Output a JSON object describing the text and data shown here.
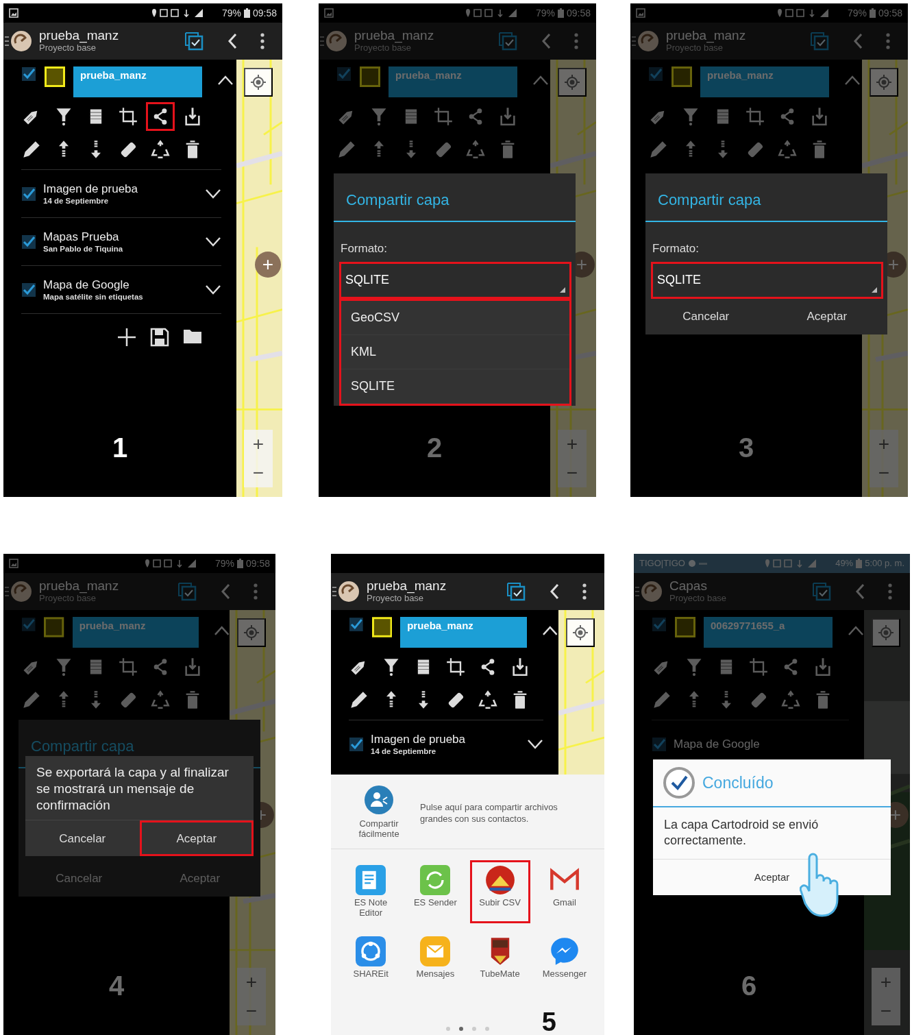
{
  "panels": [
    {
      "step": "1",
      "dimmed": false,
      "status_bar": {
        "kind": "dark",
        "battery": "79%",
        "time": "09:58"
      },
      "app_bar": {
        "title": "prueba_manz",
        "subtitle": "Proyecto base"
      },
      "active_layer": {
        "name": "prueba_manz",
        "checked": true,
        "expanded": true
      },
      "tools": [
        {
          "kind": "tag",
          "highlighted": false
        },
        {
          "kind": "filter",
          "highlighted": false
        },
        {
          "kind": "table",
          "highlighted": false
        },
        {
          "kind": "crop",
          "highlighted": false
        },
        {
          "kind": "share",
          "highlighted": true
        },
        {
          "kind": "export",
          "highlighted": false
        },
        {
          "kind": "pencil",
          "highlighted": false
        },
        {
          "kind": "up",
          "highlighted": false
        },
        {
          "kind": "down",
          "highlighted": false
        },
        {
          "kind": "eraser",
          "highlighted": false
        },
        {
          "kind": "recycle",
          "highlighted": false
        },
        {
          "kind": "trash",
          "highlighted": false
        }
      ],
      "layers": [
        {
          "title": "Imagen de prueba",
          "subtitle": "14 de Septiembre",
          "checked": true,
          "expanded": false
        },
        {
          "title": "Mapas Prueba",
          "subtitle": "San Pablo de Tiquina",
          "checked": true,
          "expanded": false
        },
        {
          "title": "Mapa de Google",
          "subtitle": "Mapa satélite sin etiquetas",
          "checked": true,
          "expanded": false
        }
      ],
      "layer_actions": true,
      "map": {
        "kind": "street",
        "fab": "+",
        "zoom_in": "+",
        "zoom_out": "−"
      }
    },
    {
      "step": "2",
      "dimmed": true,
      "status_bar": {
        "kind": "dark",
        "battery": "79%",
        "time": "09:58"
      },
      "app_bar": {
        "title": "prueba_manz",
        "subtitle": "Proyecto base"
      },
      "active_layer": {
        "name": "prueba_manz",
        "checked": true,
        "expanded": true
      },
      "tools": [
        {
          "kind": "tag",
          "highlighted": false
        },
        {
          "kind": "filter",
          "highlighted": false
        },
        {
          "kind": "table",
          "highlighted": false
        },
        {
          "kind": "crop",
          "highlighted": false
        },
        {
          "kind": "share",
          "highlighted": false
        },
        {
          "kind": "export",
          "highlighted": false
        },
        {
          "kind": "pencil",
          "highlighted": false
        },
        {
          "kind": "up",
          "highlighted": false
        },
        {
          "kind": "down",
          "highlighted": false
        },
        {
          "kind": "eraser",
          "highlighted": false
        },
        {
          "kind": "recycle",
          "highlighted": false
        },
        {
          "kind": "trash",
          "highlighted": false
        }
      ],
      "map": {
        "kind": "street",
        "fab": "+",
        "zoom_in": "+",
        "zoom_out": "−"
      },
      "dialogs": [
        {
          "kind": "format",
          "dimmed": false,
          "title": "Compartir capa",
          "label": "Formato:",
          "select": {
            "value": "SQLITE",
            "highlighted": true
          },
          "dropdown": {
            "highlighted": true,
            "options": [
              "GeoCSV",
              "KML",
              "SQLITE"
            ]
          }
        }
      ]
    },
    {
      "step": "3",
      "dimmed": true,
      "status_bar": {
        "kind": "dark",
        "battery": "79%",
        "time": "09:58"
      },
      "app_bar": {
        "title": "prueba_manz",
        "subtitle": "Proyecto base"
      },
      "active_layer": {
        "name": "prueba_manz",
        "checked": true,
        "expanded": true
      },
      "tools": [
        {
          "kind": "tag",
          "highlighted": false
        },
        {
          "kind": "filter",
          "highlighted": false
        },
        {
          "kind": "table",
          "highlighted": false
        },
        {
          "kind": "crop",
          "highlighted": false
        },
        {
          "kind": "share",
          "highlighted": false
        },
        {
          "kind": "export",
          "highlighted": false
        },
        {
          "kind": "pencil",
          "highlighted": false
        },
        {
          "kind": "up",
          "highlighted": false
        },
        {
          "kind": "down",
          "highlighted": false
        },
        {
          "kind": "eraser",
          "highlighted": false
        },
        {
          "kind": "recycle",
          "highlighted": false
        },
        {
          "kind": "trash",
          "highlighted": false
        }
      ],
      "map": {
        "kind": "street",
        "fab": "+",
        "zoom_in": "+",
        "zoom_out": "−"
      },
      "dialogs": [
        {
          "kind": "format",
          "dimmed": false,
          "title": "Compartir capa",
          "label": "Formato:",
          "select": {
            "value": "SQLITE",
            "highlighted": true
          },
          "buttons": [
            {
              "label": "Cancelar",
              "highlighted": false
            },
            {
              "label": "Aceptar",
              "highlighted": false
            }
          ]
        }
      ]
    },
    {
      "step": "4",
      "dimmed": true,
      "status_bar": {
        "kind": "dark",
        "battery": "79%",
        "time": "09:58"
      },
      "app_bar": {
        "title": "prueba_manz",
        "subtitle": "Proyecto base"
      },
      "active_layer": {
        "name": "prueba_manz",
        "checked": true,
        "expanded": true
      },
      "tools": [
        {
          "kind": "tag",
          "highlighted": false
        },
        {
          "kind": "filter",
          "highlighted": false
        },
        {
          "kind": "table",
          "highlighted": false
        },
        {
          "kind": "crop",
          "highlighted": false
        },
        {
          "kind": "share",
          "highlighted": false
        },
        {
          "kind": "export",
          "highlighted": false
        },
        {
          "kind": "pencil",
          "highlighted": false
        },
        {
          "kind": "up",
          "highlighted": false
        },
        {
          "kind": "down",
          "highlighted": false
        },
        {
          "kind": "eraser",
          "highlighted": false
        },
        {
          "kind": "recycle",
          "highlighted": false
        },
        {
          "kind": "trash",
          "highlighted": false
        }
      ],
      "map": {
        "kind": "street",
        "fab": "+",
        "zoom_in": "+",
        "zoom_out": "−"
      },
      "dialogs": [
        {
          "kind": "format",
          "dimmed": true,
          "title": "Compartir capa",
          "buttons": [
            {
              "label": "Cancelar",
              "highlighted": false
            },
            {
              "label": "Aceptar",
              "highlighted": false
            }
          ]
        },
        {
          "kind": "message",
          "dimmed": false,
          "text": "Se exportará la capa y al finalizar se mostrará un mensaje de confirmación",
          "buttons": [
            {
              "label": "Cancelar",
              "highlighted": false
            },
            {
              "label": "Aceptar",
              "highlighted": true
            }
          ]
        }
      ]
    },
    {
      "step": "5",
      "dimmed": false,
      "app_bar": {
        "title": "prueba_manz",
        "subtitle": "Proyecto base"
      },
      "active_layer": {
        "name": "prueba_manz",
        "checked": true,
        "expanded": true
      },
      "tools": [
        {
          "kind": "tag",
          "highlighted": false
        },
        {
          "kind": "filter",
          "highlighted": false
        },
        {
          "kind": "table",
          "highlighted": false
        },
        {
          "kind": "crop",
          "highlighted": false
        },
        {
          "kind": "share",
          "highlighted": false
        },
        {
          "kind": "export",
          "highlighted": false
        },
        {
          "kind": "pencil",
          "highlighted": false
        },
        {
          "kind": "up",
          "highlighted": false
        },
        {
          "kind": "down",
          "highlighted": false
        },
        {
          "kind": "eraser",
          "highlighted": false
        },
        {
          "kind": "recycle",
          "highlighted": false
        },
        {
          "kind": "trash",
          "highlighted": false
        }
      ],
      "layers": [
        {
          "title": "Imagen de prueba",
          "subtitle": "14 de Septiembre",
          "checked": true,
          "expanded": false
        }
      ],
      "map": {
        "kind": "street"
      },
      "share_sheet": {
        "quick_label": "Compartir fácilmente",
        "quick_text": "Pulse aquí para compartir archivos grandes con sus contactos.",
        "apps": [
          {
            "label": "ES Note Editor",
            "kind": "note",
            "highlighted": false
          },
          {
            "label": "ES Sender",
            "kind": "sender",
            "highlighted": false
          },
          {
            "label": "Subir CSV",
            "kind": "csv",
            "highlighted": true
          },
          {
            "label": "Gmail",
            "kind": "mail",
            "highlighted": false
          },
          {
            "label": "SHAREit",
            "kind": "shareit",
            "highlighted": false
          },
          {
            "label": "Mensajes",
            "kind": "messages",
            "highlighted": false
          },
          {
            "label": "TubeMate",
            "kind": "tubemate",
            "highlighted": false
          },
          {
            "label": "Messenger",
            "kind": "messenger",
            "highlighted": false
          }
        ],
        "pages": [
          {
            "selected": false
          },
          {
            "selected": true
          },
          {
            "selected": false
          },
          {
            "selected": false
          }
        ]
      }
    },
    {
      "step": "6",
      "dimmed": true,
      "status_bar": {
        "kind": "tinted",
        "carrier": "TIGO|TIGO",
        "battery": "49%",
        "time": "5:00 p. m."
      },
      "app_bar": {
        "title": "Capas",
        "subtitle": "Proyecto base"
      },
      "active_layer": {
        "name": "00629771655_a",
        "checked": true,
        "expanded": true
      },
      "tools": [
        {
          "kind": "tag",
          "highlighted": false
        },
        {
          "kind": "filter",
          "highlighted": false
        },
        {
          "kind": "table",
          "highlighted": false
        },
        {
          "kind": "crop",
          "highlighted": false
        },
        {
          "kind": "share",
          "highlighted": false
        },
        {
          "kind": "export",
          "highlighted": false
        },
        {
          "kind": "pencil",
          "highlighted": false
        },
        {
          "kind": "up",
          "highlighted": false
        },
        {
          "kind": "down",
          "highlighted": false
        },
        {
          "kind": "eraser",
          "highlighted": false
        },
        {
          "kind": "recycle",
          "highlighted": false
        },
        {
          "kind": "trash",
          "highlighted": false
        }
      ],
      "layers": [
        {
          "title": "Mapa de Google",
          "checked": true
        }
      ],
      "map": {
        "kind": "satellite",
        "fab": "+",
        "zoom_in": "+",
        "zoom_out": "−"
      },
      "dialogs": [
        {
          "kind": "done",
          "dimmed": false,
          "title": "Concluído",
          "text": "La capa Cartodroid se envió correctamente.",
          "buttons": [
            {
              "label": "Aceptar",
              "highlighted": false
            }
          ]
        }
      ],
      "hand_cursor": true
    }
  ]
}
